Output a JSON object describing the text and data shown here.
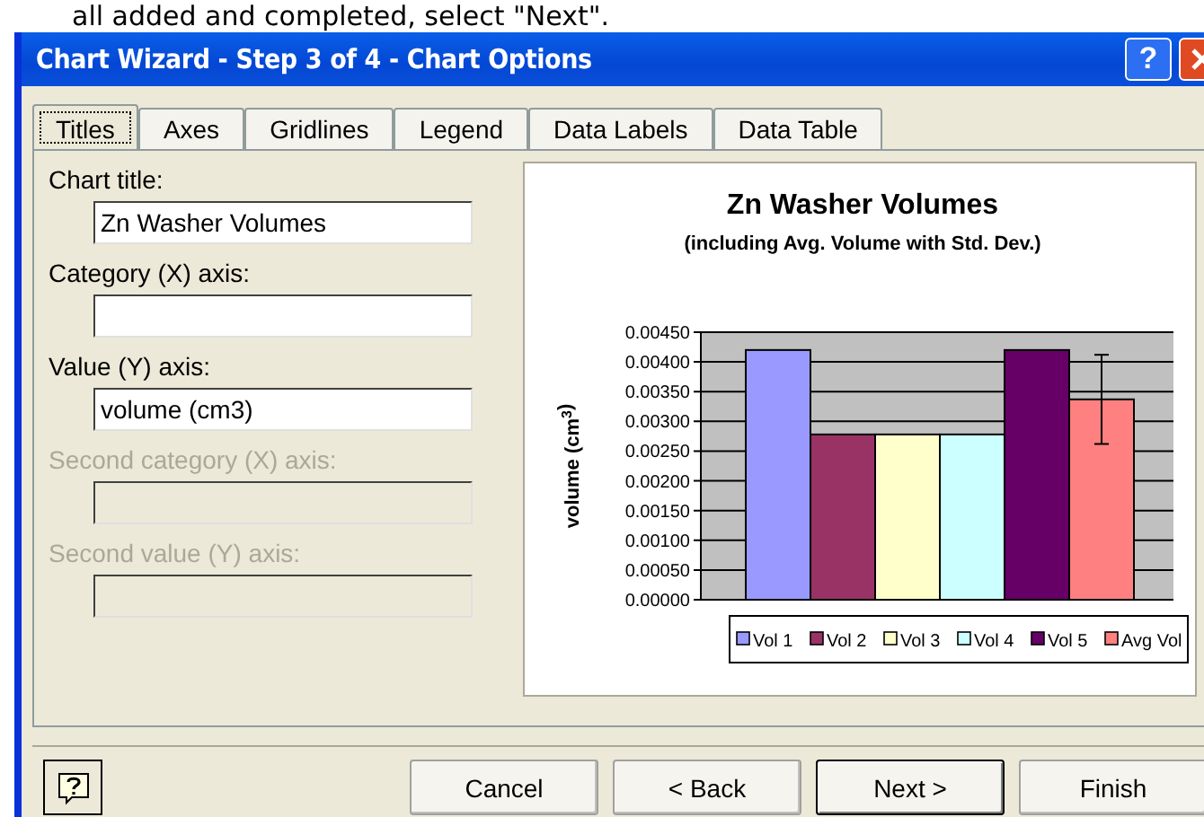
{
  "caption": "all added and completed, select \"Next\".",
  "window": {
    "title": "Chart Wizard - Step 3 of 4 - Chart Options",
    "help_glyph": "?"
  },
  "tabs": [
    {
      "label": "Titles",
      "selected": true
    },
    {
      "label": "Axes",
      "selected": false
    },
    {
      "label": "Gridlines",
      "selected": false
    },
    {
      "label": "Legend",
      "selected": false
    },
    {
      "label": "Data Labels",
      "selected": false
    },
    {
      "label": "Data Table",
      "selected": false
    }
  ],
  "fields": [
    {
      "label": "Chart title:",
      "value": "Zn Washer Volumes",
      "disabled": false
    },
    {
      "label": "Category (X) axis:",
      "disabled": false
    },
    {
      "label": "Value (Y) axis:",
      "value": "volume (cm3)",
      "disabled": false
    },
    {
      "label": "Second category (X) axis:",
      "disabled": true
    },
    {
      "label": "Second value (Y) axis:",
      "disabled": true
    }
  ],
  "preview": {
    "chart_data": {
      "type": "bar",
      "title": "Zn Washer Volumes",
      "subtitle": "(including Avg. Volume with Std. Dev.)",
      "ylabel": "volume (cm$^{3}$)",
      "ylim": [
        0,
        0.0045
      ],
      "yticks": [
        {
          "value": 0,
          "label": "0.00000"
        },
        {
          "value": 0.0005,
          "label": "0.00050"
        },
        {
          "value": 0.001,
          "label": "0.00100"
        },
        {
          "value": 0.0015,
          "label": "0.00150"
        },
        {
          "value": 0.002,
          "label": "0.00200"
        },
        {
          "value": 0.0025,
          "label": "0.00250"
        },
        {
          "value": 0.003,
          "label": "0.00300"
        },
        {
          "value": 0.0035,
          "label": "0.00350"
        },
        {
          "value": 0.004,
          "label": "0.00400"
        },
        {
          "value": 0.0045,
          "label": "0.00450"
        }
      ],
      "series": [
        {
          "name": "Vol 1",
          "color": "#9999ff",
          "values": [
            0.0042
          ]
        },
        {
          "name": "Vol 2",
          "color": "#993366",
          "values": [
            0.00278
          ]
        },
        {
          "name": "Vol 3",
          "color": "#ffffcc",
          "values": [
            0.00278
          ]
        },
        {
          "name": "Vol 4",
          "color": "#ccffff",
          "values": [
            0.00278
          ]
        },
        {
          "name": "Vol 5",
          "color": "#660066",
          "values": [
            0.0042
          ]
        },
        {
          "name": "Avg Vol",
          "color": "#ff8080",
          "values": [
            0.00337
          ],
          "errors": [
            0.00075
          ]
        }
      ],
      "grid": true,
      "legend": "bottom"
    }
  },
  "buttons": [
    {
      "label": "Cancel",
      "default": false
    },
    {
      "label": "< Back",
      "default": false
    },
    {
      "label": "Next >",
      "default": true
    },
    {
      "label": "Finish",
      "default": false
    }
  ]
}
